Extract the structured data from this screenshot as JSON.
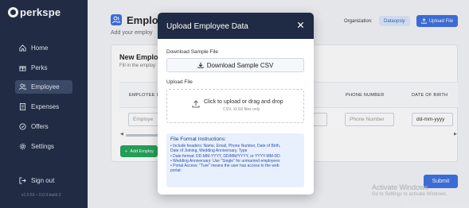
{
  "brand": {
    "logo_text": "perkspe"
  },
  "sidebar": {
    "items": [
      {
        "label": "Home",
        "icon": "home-icon",
        "active": false
      },
      {
        "label": "Perks",
        "icon": "perks-icon",
        "active": false
      },
      {
        "label": "Employee",
        "icon": "users-icon",
        "active": true
      },
      {
        "label": "Expenses",
        "icon": "expenses-icon",
        "active": false
      },
      {
        "label": "Offers",
        "icon": "offers-icon",
        "active": false
      },
      {
        "label": "Settings",
        "icon": "gear-icon",
        "active": false
      }
    ],
    "signout_label": "Sign out",
    "version": "v1.0.53 – 0.0.3-build.2"
  },
  "header": {
    "title": "Employ",
    "subtitle": "Add your employ",
    "org_label": "Organization:",
    "org_name": "Dataopsly",
    "upload_button": "Upload File"
  },
  "card": {
    "title": "New Employ",
    "subtitle": "Fill in the employ",
    "columns": [
      "EMPLOYEE ID",
      "PHONE NUMBER",
      "DATE OF BIRTH"
    ],
    "row": {
      "employee_placeholder": "Employe",
      "phone_placeholder": "Phone Number",
      "dob_value": "dd-mm-yyyy"
    },
    "add_button": "Add Employ",
    "submit_button": "Submit"
  },
  "modal": {
    "title": "Upload Employee Data",
    "download_label": "Download Sample File",
    "download_button": "Download Sample CSV",
    "upload_label": "Upload File",
    "dropzone_text": "Click to upload or drag and drop",
    "dropzone_hint": "CSV, XLSX files only",
    "instructions_title": "File Format Instructions:",
    "instructions": [
      "• Include headers: Name, Email, Phone Number, Date of Birth,",
      "  Date of Joining, Wedding Anniversary, Type",
      "• Date format: DD-MM-YYYY, DD/MM/YYYY, or YYYY-MM-DD",
      "• Wedding Anniversary: Use \"Single\" for unmarried employees",
      "• Portal Access: \"Ture\" means the user has access to the web",
      "  portal:"
    ]
  },
  "watermark": {
    "title": "Activate Windows",
    "subtitle": "Go to Settings to activate Windows."
  },
  "colors": {
    "sidebar_bg": "#1f2a44",
    "accent": "#3b6fe0",
    "add_button": "#22a559"
  }
}
